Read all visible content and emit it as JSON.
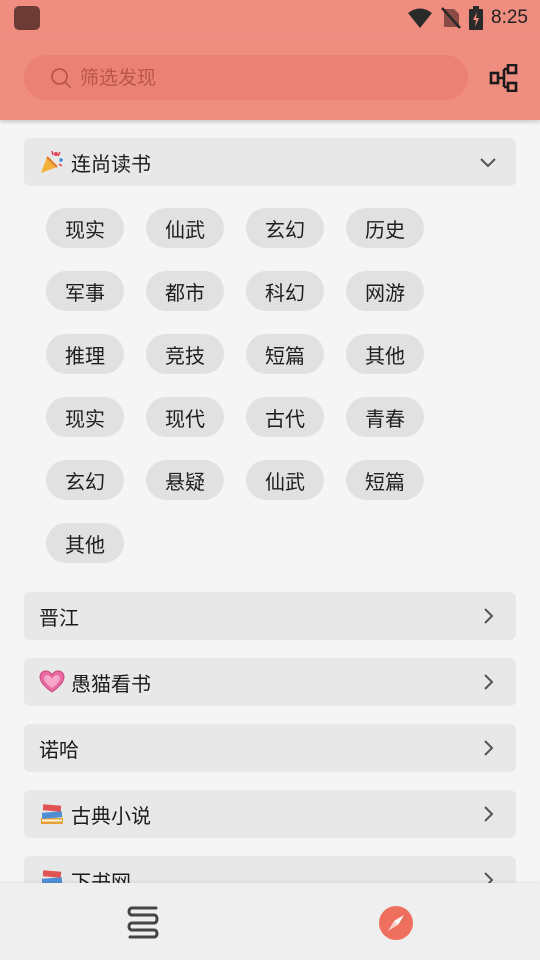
{
  "status": {
    "time": "8:25"
  },
  "search": {
    "placeholder": "筛选发现"
  },
  "groups": [
    {
      "title": "连尚读书",
      "emoji": "party-popper",
      "expanded": true
    },
    {
      "title": "晋江",
      "emoji": "",
      "expanded": false
    },
    {
      "title": "愚猫看书",
      "emoji": "pink-heart",
      "expanded": false
    },
    {
      "title": "诺哈",
      "emoji": "",
      "expanded": false
    },
    {
      "title": "古典小说",
      "emoji": "books",
      "expanded": false
    },
    {
      "title": "下书网",
      "emoji": "books",
      "expanded": false
    }
  ],
  "tags": [
    "现实",
    "仙武",
    "玄幻",
    "历史",
    "军事",
    "都市",
    "科幻",
    "网游",
    "推理",
    "竞技",
    "短篇",
    "其他",
    "现实",
    "现代",
    "古代",
    "青春",
    "玄幻",
    "悬疑",
    "仙武",
    "短篇",
    "其他"
  ],
  "colors": {
    "accent": "#ef8d80",
    "tag_bg": "#e1e1e1",
    "header_bg": "#e8e8e8"
  },
  "bottom_nav": {
    "items": [
      {
        "icon": "bookshelf-icon",
        "active": false
      },
      {
        "icon": "compass-icon",
        "active": true
      }
    ]
  }
}
